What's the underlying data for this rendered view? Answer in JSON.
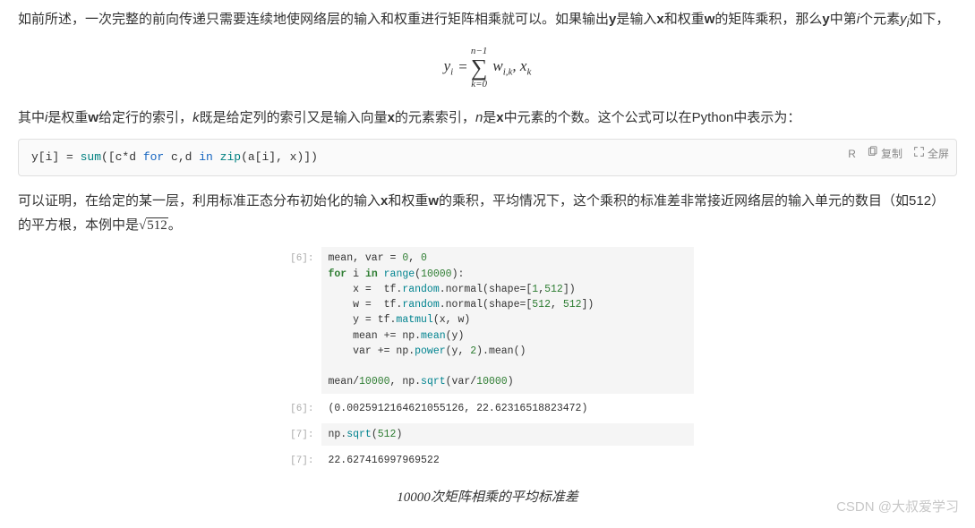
{
  "para1_pre": "如前所述，一次完整的前向传递只需要连续地使网络层的输入和权重进行矩阵相乘就可以。如果输出",
  "para1_y": "y",
  "para1_mid1": "是输入",
  "para1_x": "x",
  "para1_mid2": "和权重",
  "para1_w": "w",
  "para1_mid3": "的矩阵乘积，那么",
  "para1_y2": "y",
  "para1_mid4": "中第",
  "para1_i": "i",
  "para1_mid5": "个元素",
  "para1_yi": "y",
  "para1_yi_sub": "i",
  "para1_end": "如下，",
  "eq_yi": "y",
  "eq_yi_sub": "i",
  "eq_eq": " = ",
  "eq_sum_top": "n−1",
  "eq_sum_sym": "∑",
  "eq_sum_bot": "k=0",
  "eq_rhs": "w",
  "eq_rhs_ik": "i,k",
  "eq_rhs_comma": ", x",
  "eq_rhs_k": "k",
  "para2_pre": "其中",
  "para2_i": "i",
  "para2_mid1": "是权重",
  "para2_w": "w",
  "para2_mid2": "给定行的索引，",
  "para2_k": "k",
  "para2_mid3": "既是给定列的索引又是输入向量",
  "para2_x": "x",
  "para2_mid4": "的元素索引，",
  "para2_n": "n",
  "para2_mid5": "是",
  "para2_x2": "x",
  "para2_end": "中元素的个数。这个公式可以在Python中表示为：",
  "code1_pre": "y[i] = ",
  "code1_sum": "sum",
  "code1_mid": "([c*d ",
  "code1_for": "for",
  "code1_mid2": " c,d ",
  "code1_in": "in",
  "code1_mid3": " ",
  "code1_zip": "zip",
  "code1_end": "(a[i], x)])",
  "toolbar_lang": "R",
  "toolbar_copy": "复制",
  "toolbar_full": "全屏",
  "para3_pre": "可以证明，在给定的某一层，利用标准正态分布初始化的输入",
  "para3_x": "x",
  "para3_mid1": "和权重",
  "para3_w": "w",
  "para3_mid2": "的乘积，平均情况下，这个乘积的标准差非常接近网络层的输入单元的数目（如512）的平方根，本例中是",
  "para3_sqrt_sym": "√",
  "para3_sqrt_val": "512",
  "para3_end": "。",
  "cell1_prompt": "[6]:",
  "cell1_l1a": "mean, var = ",
  "cell1_l1b": "0",
  "cell1_l1c": ", ",
  "cell1_l1d": "0",
  "cell1_l2a": "for",
  "cell1_l2b": " i ",
  "cell1_l2c": "in",
  "cell1_l2d": " ",
  "cell1_l2e": "range",
  "cell1_l2f": "(",
  "cell1_l2g": "10000",
  "cell1_l2h": "):",
  "cell1_l3a": "    x =  tf.",
  "cell1_l3b": "random",
  "cell1_l3c": ".normal(shape=[",
  "cell1_l3d": "1",
  "cell1_l3e": ",",
  "cell1_l3f": "512",
  "cell1_l3g": "])",
  "cell1_l4a": "    w =  tf.",
  "cell1_l4b": "random",
  "cell1_l4c": ".normal(shape=[",
  "cell1_l4d": "512",
  "cell1_l4e": ", ",
  "cell1_l4f": "512",
  "cell1_l4g": "])",
  "cell1_l5a": "    y = tf.",
  "cell1_l5b": "matmul",
  "cell1_l5c": "(x, w)",
  "cell1_l6a": "    mean += np.",
  "cell1_l6b": "mean",
  "cell1_l6c": "(y)",
  "cell1_l7a": "    var += np.",
  "cell1_l7b": "power",
  "cell1_l7c": "(y, ",
  "cell1_l7d": "2",
  "cell1_l7e": ").mean()",
  "cell1_blank": " ",
  "cell1_l8a": "mean/",
  "cell1_l8b": "10000",
  "cell1_l8c": ", np.",
  "cell1_l8d": "sqrt",
  "cell1_l8e": "(var/",
  "cell1_l8f": "10000",
  "cell1_l8g": ")",
  "cell1_out_prompt": "[6]:",
  "cell1_out": "(0.0025912164621055126, 22.62316518823472)",
  "cell2_prompt": "[7]:",
  "cell2_l1a": "np.",
  "cell2_l1b": "sqrt",
  "cell2_l1c": "(",
  "cell2_l1d": "512",
  "cell2_l1e": ")",
  "cell2_out_prompt": "[7]:",
  "cell2_out": "22.627416997969522",
  "caption": "10000次矩阵相乘的平均标准差",
  "watermark": "CSDN @大叔爱学习"
}
